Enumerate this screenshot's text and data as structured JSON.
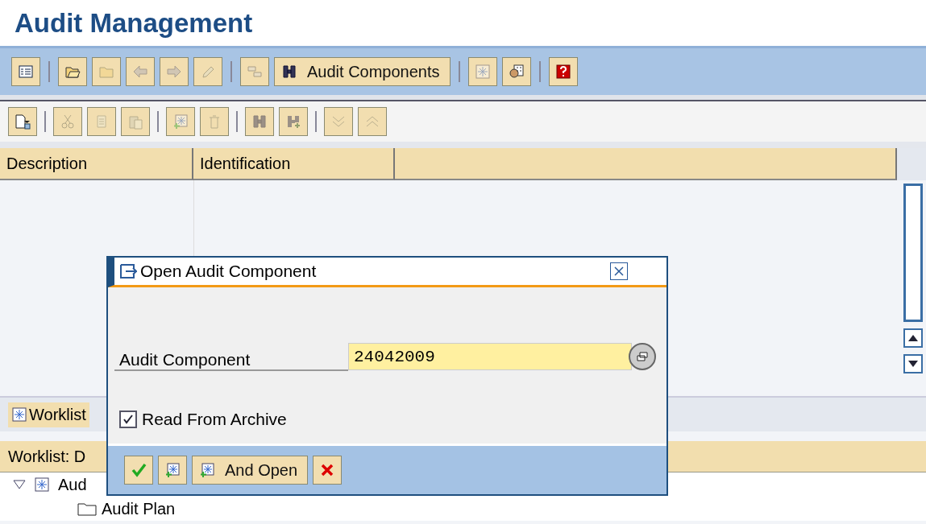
{
  "page_title": "Audit Management",
  "application_toolbar": [
    [
      {
        "disabled": false
      }
    ],
    [
      {
        "disabled": false
      },
      {
        "disabled": true
      },
      {
        "disabled": true
      },
      {
        "disabled": true
      },
      {
        "disabled": true
      }
    ],
    [
      {
        "disabled": true
      },
      {
        "disabled": false,
        "label": "Audit Components"
      }
    ],
    [
      {
        "disabled": true
      },
      {
        "disabled": false
      }
    ],
    [
      {
        "disabled": false
      }
    ]
  ],
  "list_toolbar": [
    [
      {
        "disabled": false
      }
    ],
    [
      {
        "disabled": true
      },
      {
        "disabled": true
      },
      {
        "disabled": true
      }
    ],
    [
      {
        "disabled": true
      },
      {
        "disabled": true
      }
    ],
    [
      {
        "disabled": true
      },
      {
        "disabled": true
      }
    ],
    [
      {
        "disabled": true
      },
      {
        "disabled": true
      }
    ]
  ],
  "table": {
    "columns": [
      "Description",
      "Identification"
    ]
  },
  "worklist_tab": {
    "label": "Worklist"
  },
  "worklist_header": "Worklist: D",
  "tree": [
    {
      "label": "Aud",
      "expanded": true,
      "children": [
        {
          "label": "Audit Plan"
        }
      ]
    }
  ],
  "dialog": {
    "title": "Open Audit Component",
    "field": {
      "label": "Audit Component",
      "value": "24042009"
    },
    "checkbox": {
      "label": "Read From Archive",
      "checked": true
    },
    "buttons": [
      {
        "kind": "icon"
      },
      {
        "kind": "icon"
      },
      {
        "kind": "text",
        "label": "And Open"
      },
      {
        "kind": "icon"
      }
    ]
  }
}
